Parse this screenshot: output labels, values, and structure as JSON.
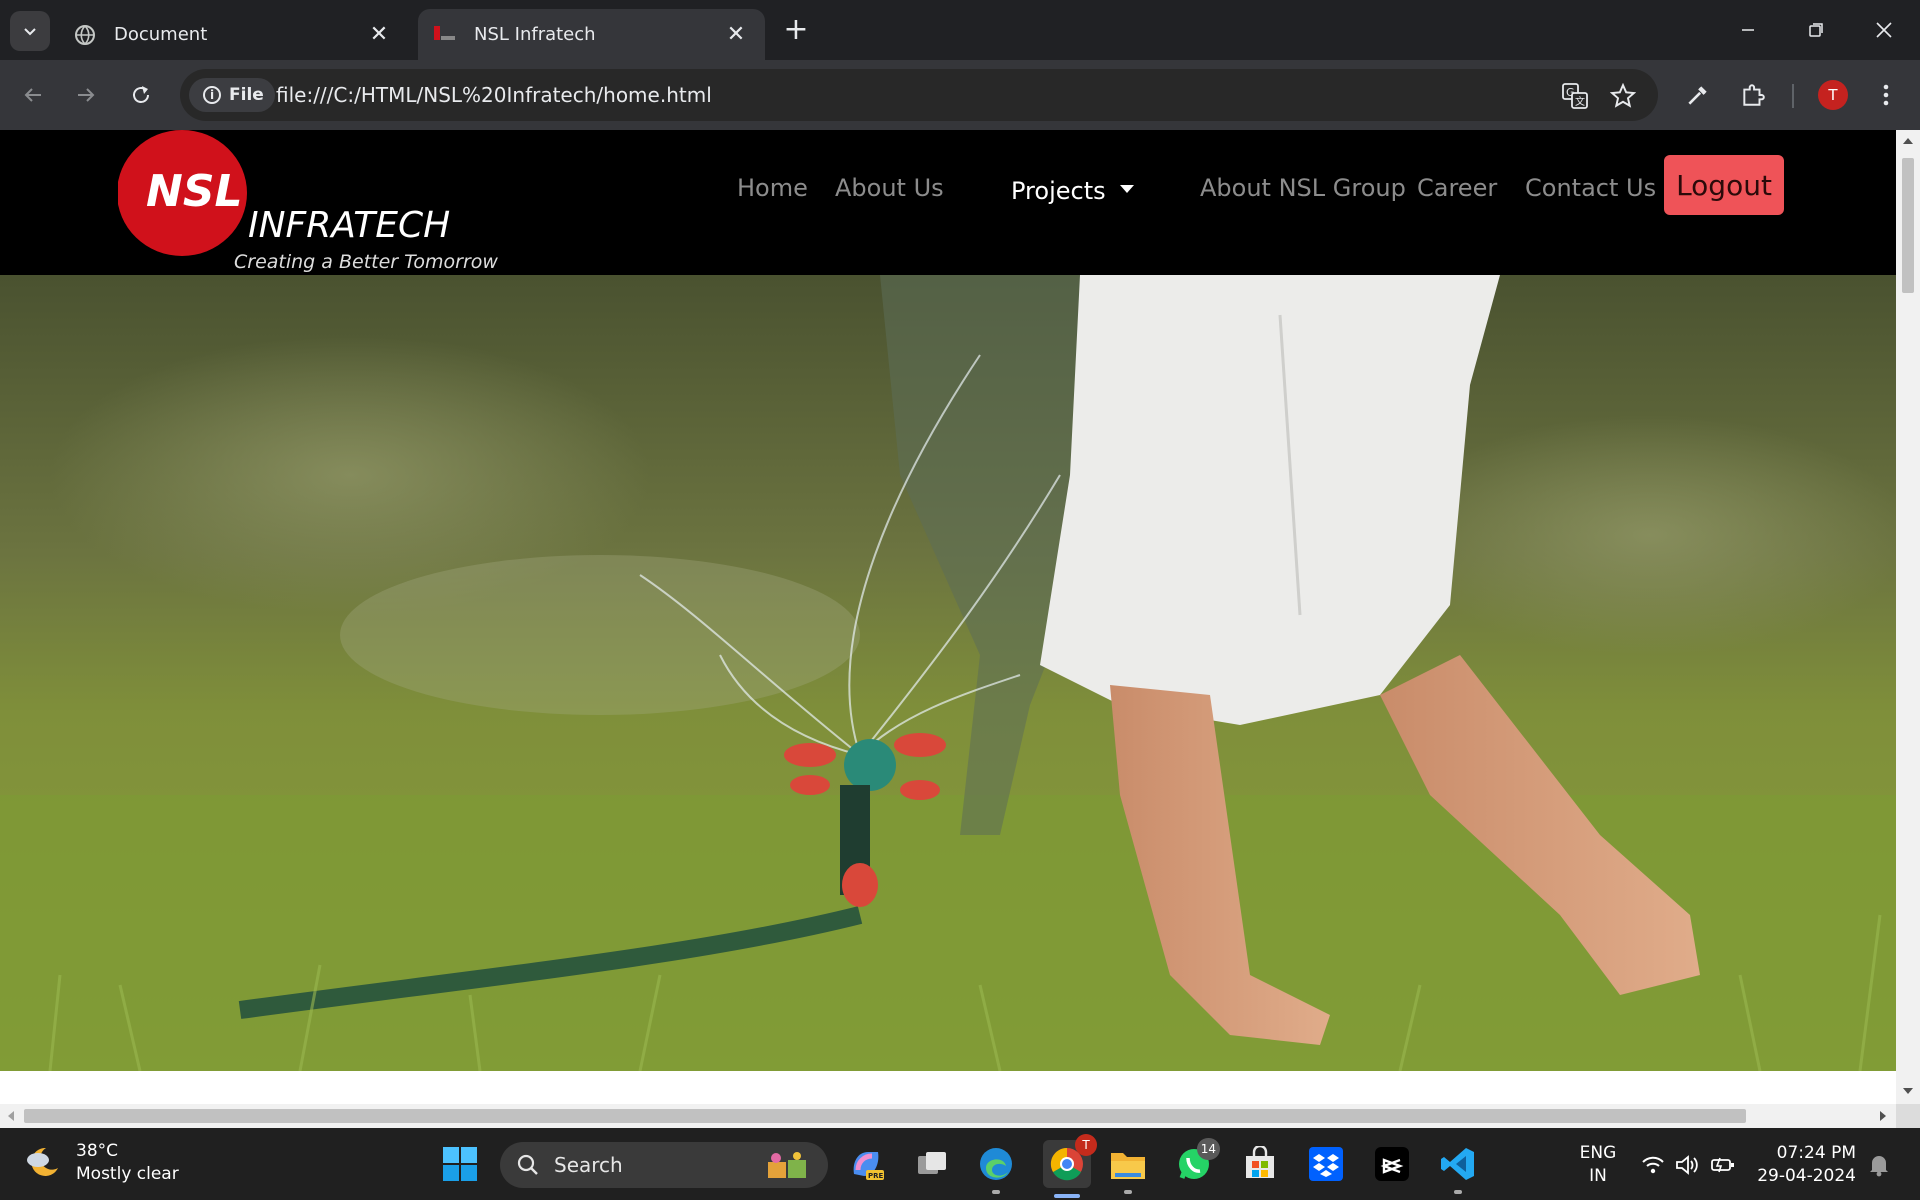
{
  "browser": {
    "tabs": [
      {
        "title": "Document",
        "active": false
      },
      {
        "title": "NSL Infratech",
        "active": true
      }
    ],
    "omnibox": {
      "chip_label": "File",
      "url": "file:///C:/HTML/NSL%20Infratech/home.html"
    },
    "profile_initial": "T"
  },
  "site": {
    "logo": {
      "mark": "NSL",
      "name": "INFRATECH",
      "tagline": "Creating a Better Tomorrow"
    },
    "nav": {
      "home": "Home",
      "about_us": "About Us",
      "projects": "Projects",
      "about_group": "About NSL Group",
      "career": "Career",
      "contact_us": "Contact Us",
      "logout": "Logout"
    },
    "colors": {
      "nav_bg": "#000000",
      "nav_link": "#8c8c8c",
      "logout_bg": "#ef5358",
      "logo_red": "#d0111b"
    },
    "hero": {
      "description": "hero-image-sprinkler"
    }
  },
  "taskbar": {
    "weather": {
      "temp": "38°C",
      "condition": "Mostly clear"
    },
    "search_placeholder": "Search",
    "apps": [
      {
        "name": "copilot-icon"
      },
      {
        "name": "task-view-icon"
      },
      {
        "name": "edge-icon"
      },
      {
        "name": "chrome-icon",
        "badge": "T"
      },
      {
        "name": "file-explorer-icon"
      },
      {
        "name": "whatsapp-icon",
        "badge": "14"
      },
      {
        "name": "microsoft-store-icon"
      },
      {
        "name": "dropbox-icon"
      },
      {
        "name": "capcut-icon"
      },
      {
        "name": "vscode-icon"
      }
    ],
    "language": {
      "line1": "ENG",
      "line2": "IN"
    },
    "clock": {
      "time": "07:24 PM",
      "date": "29-04-2024"
    }
  }
}
